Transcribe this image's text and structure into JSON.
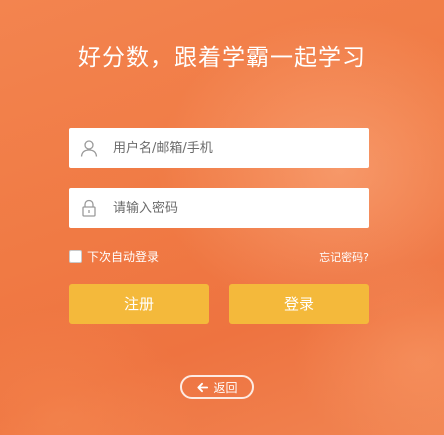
{
  "header": {
    "title": "好分数，跟着学霸一起学习"
  },
  "form": {
    "username": {
      "placeholder": "用户名/邮箱/手机",
      "value": "",
      "icon": "user-icon"
    },
    "password": {
      "placeholder": "请输入密码",
      "value": "",
      "icon": "lock-icon"
    },
    "remember_label": "下次自动登录",
    "remember_checked": false,
    "forgot_label": "忘记密码?"
  },
  "actions": {
    "register_label": "注册",
    "login_label": "登录",
    "back_label": "返回",
    "back_icon": "arrow-left-icon"
  },
  "colors": {
    "background": "#f07a44",
    "button": "#f4b93b",
    "text": "#ffffff"
  }
}
